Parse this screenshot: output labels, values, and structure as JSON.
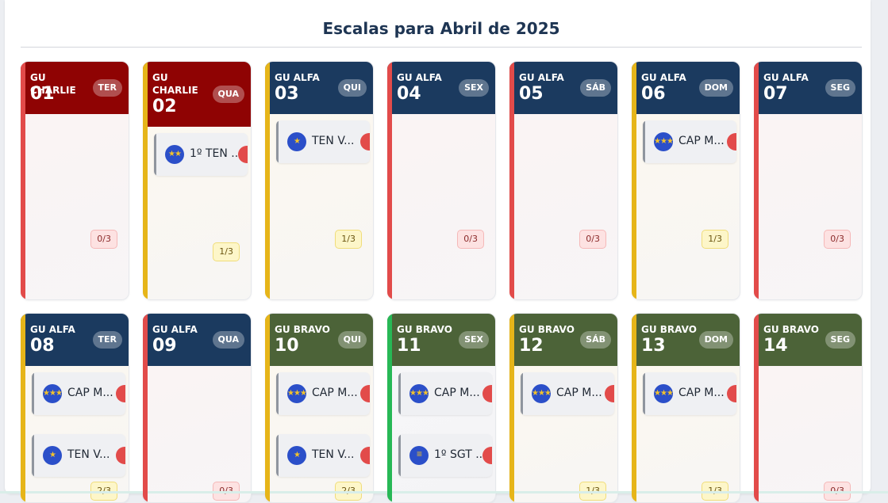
{
  "page": {
    "title": "Escalas para Abril de 2025"
  },
  "rows": [
    {
      "cards": [
        {
          "group": "GU CHARLIE",
          "day": "01",
          "weekday": "TER",
          "count": "0/3",
          "entries": []
        },
        {
          "group": "GU CHARLIE",
          "day": "02",
          "weekday": "QUA",
          "count": "1/3",
          "entries": [
            {
              "name": "1º TEN ...",
              "insignia": "★★"
            }
          ]
        },
        {
          "group": "GU ALFA",
          "day": "03",
          "weekday": "QUI",
          "count": "1/3",
          "entries": [
            {
              "name": "TEN V...",
              "insignia": "★"
            }
          ]
        },
        {
          "group": "GU ALFA",
          "day": "04",
          "weekday": "SEX",
          "count": "0/3",
          "entries": []
        },
        {
          "group": "GU ALFA",
          "day": "05",
          "weekday": "SÁB",
          "count": "0/3",
          "entries": []
        },
        {
          "group": "GU ALFA",
          "day": "06",
          "weekday": "DOM",
          "count": "1/3",
          "entries": [
            {
              "name": "CAP M...",
              "insignia": "★★★"
            }
          ]
        },
        {
          "group": "GU ALFA",
          "day": "07",
          "weekday": "SEG",
          "count": "0/3",
          "entries": []
        }
      ]
    },
    {
      "cards": [
        {
          "group": "GU ALFA",
          "day": "08",
          "weekday": "TER",
          "count": "2/3",
          "entries": [
            {
              "name": "CAP M...",
              "insignia": "★★★"
            },
            {
              "name": "TEN V...",
              "insignia": "★"
            }
          ]
        },
        {
          "group": "GU ALFA",
          "day": "09",
          "weekday": "QUA",
          "count": "0/3",
          "entries": []
        },
        {
          "group": "GU BRAVO",
          "day": "10",
          "weekday": "QUI",
          "count": "2/3",
          "entries": [
            {
              "name": "CAP M...",
              "insignia": "★★★"
            },
            {
              "name": "TEN V...",
              "insignia": "★"
            }
          ]
        },
        {
          "group": "GU BRAVO",
          "day": "11",
          "weekday": "SEX",
          "count": "",
          "entries": [
            {
              "name": "CAP M...",
              "insignia": "★★★"
            },
            {
              "name": "1º SGT ...",
              "insignia": "≡"
            }
          ]
        },
        {
          "group": "GU BRAVO",
          "day": "12",
          "weekday": "SÁB",
          "count": "1/3",
          "entries": [
            {
              "name": "CAP M...",
              "insignia": "★★★"
            }
          ]
        },
        {
          "group": "GU BRAVO",
          "day": "13",
          "weekday": "DOM",
          "count": "1/3",
          "entries": [
            {
              "name": "CAP M...",
              "insignia": "★★★"
            }
          ]
        },
        {
          "group": "GU BRAVO",
          "day": "14",
          "weekday": "SEG",
          "count": "0/3",
          "entries": []
        }
      ]
    }
  ],
  "colors": {
    "header_red": "#8f0303",
    "header_navy": "#1b3a5f",
    "header_green": "#4c6338",
    "status_red": "#e24b4a",
    "status_yellow": "#e6b519",
    "status_green": "#27b856"
  }
}
